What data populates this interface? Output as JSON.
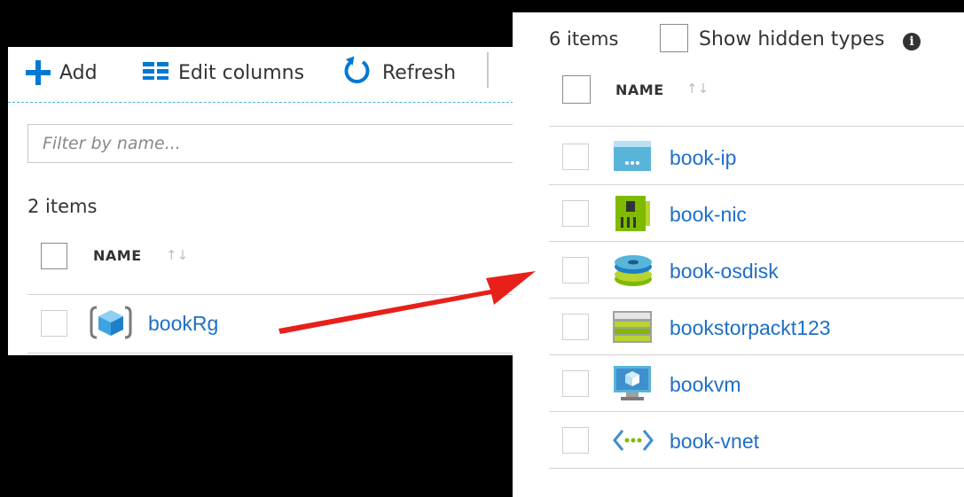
{
  "left_panel": {
    "toolbar": {
      "add_label": "Add",
      "edit_columns_label": "Edit columns",
      "refresh_label": "Refresh"
    },
    "filter": {
      "placeholder": "Filter by name...",
      "value": ""
    },
    "item_count": "2 items",
    "column_header": "NAME",
    "rows": [
      {
        "name": "bookRg",
        "icon": "resource-group-icon"
      }
    ]
  },
  "right_panel": {
    "item_count": "6 items",
    "show_hidden_label": "Show hidden types",
    "info_icon_glyph": "i",
    "column_header": "NAME",
    "rows": [
      {
        "name": "book-ip",
        "icon": "public-ip-icon"
      },
      {
        "name": "book-nic",
        "icon": "network-interface-icon"
      },
      {
        "name": "book-osdisk",
        "icon": "disk-icon"
      },
      {
        "name": "bookstorpackt123",
        "icon": "storage-account-icon"
      },
      {
        "name": "bookvm",
        "icon": "virtual-machine-icon"
      },
      {
        "name": "book-vnet",
        "icon": "virtual-network-icon"
      }
    ]
  },
  "colors": {
    "link": "#1e6fc8",
    "accent": "#0078d4",
    "arrow": "#e8201a"
  }
}
